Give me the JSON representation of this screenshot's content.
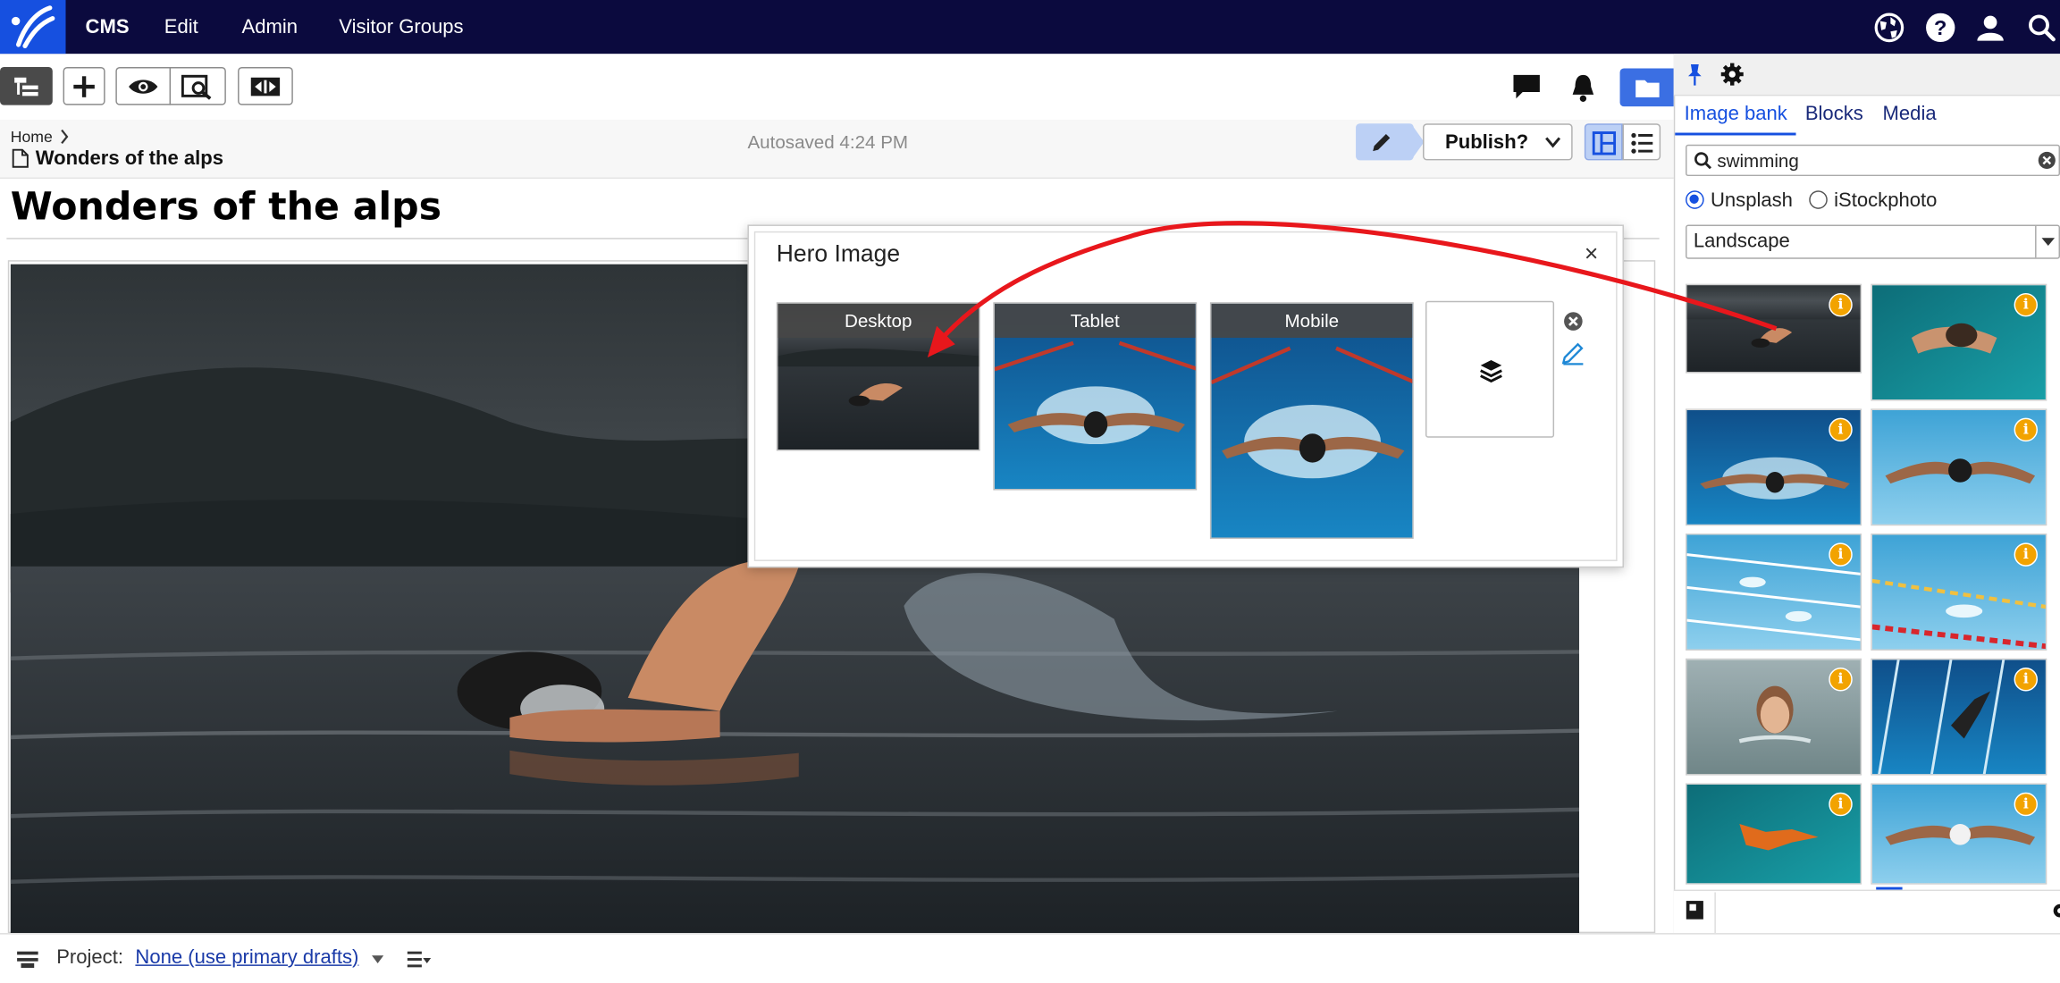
{
  "topnav": {
    "items": [
      {
        "label": "CMS"
      },
      {
        "label": "Edit"
      },
      {
        "label": "Admin"
      },
      {
        "label": "Visitor Groups"
      }
    ]
  },
  "editor": {
    "breadcrumb_home": "Home",
    "page_name": "Wonders of the alps",
    "autosaved": "Autosaved 4:24 PM",
    "publish_label": "Publish?",
    "heading": "Wonders of the alps"
  },
  "dialog": {
    "title": "Hero Image",
    "close": "×",
    "slots": [
      {
        "label": "Desktop"
      },
      {
        "label": "Tablet"
      },
      {
        "label": "Mobile"
      }
    ]
  },
  "panel": {
    "tabs": [
      {
        "label": "Image bank"
      },
      {
        "label": "Blocks"
      },
      {
        "label": "Media"
      }
    ],
    "search_value": "swimming",
    "sources": [
      {
        "label": "Unsplash",
        "checked": true
      },
      {
        "label": "iStockphoto",
        "checked": false
      }
    ],
    "orientation": "Landscape",
    "info_glyph": "i"
  },
  "footer": {
    "project_label": "Project:",
    "project_value": "None (use primary drafts)"
  },
  "colors": {
    "nav_bg": "#0b0a3e",
    "brand_blue": "#1650e0",
    "arrow_red": "#e8171c",
    "info_badge": "#f2a300"
  }
}
